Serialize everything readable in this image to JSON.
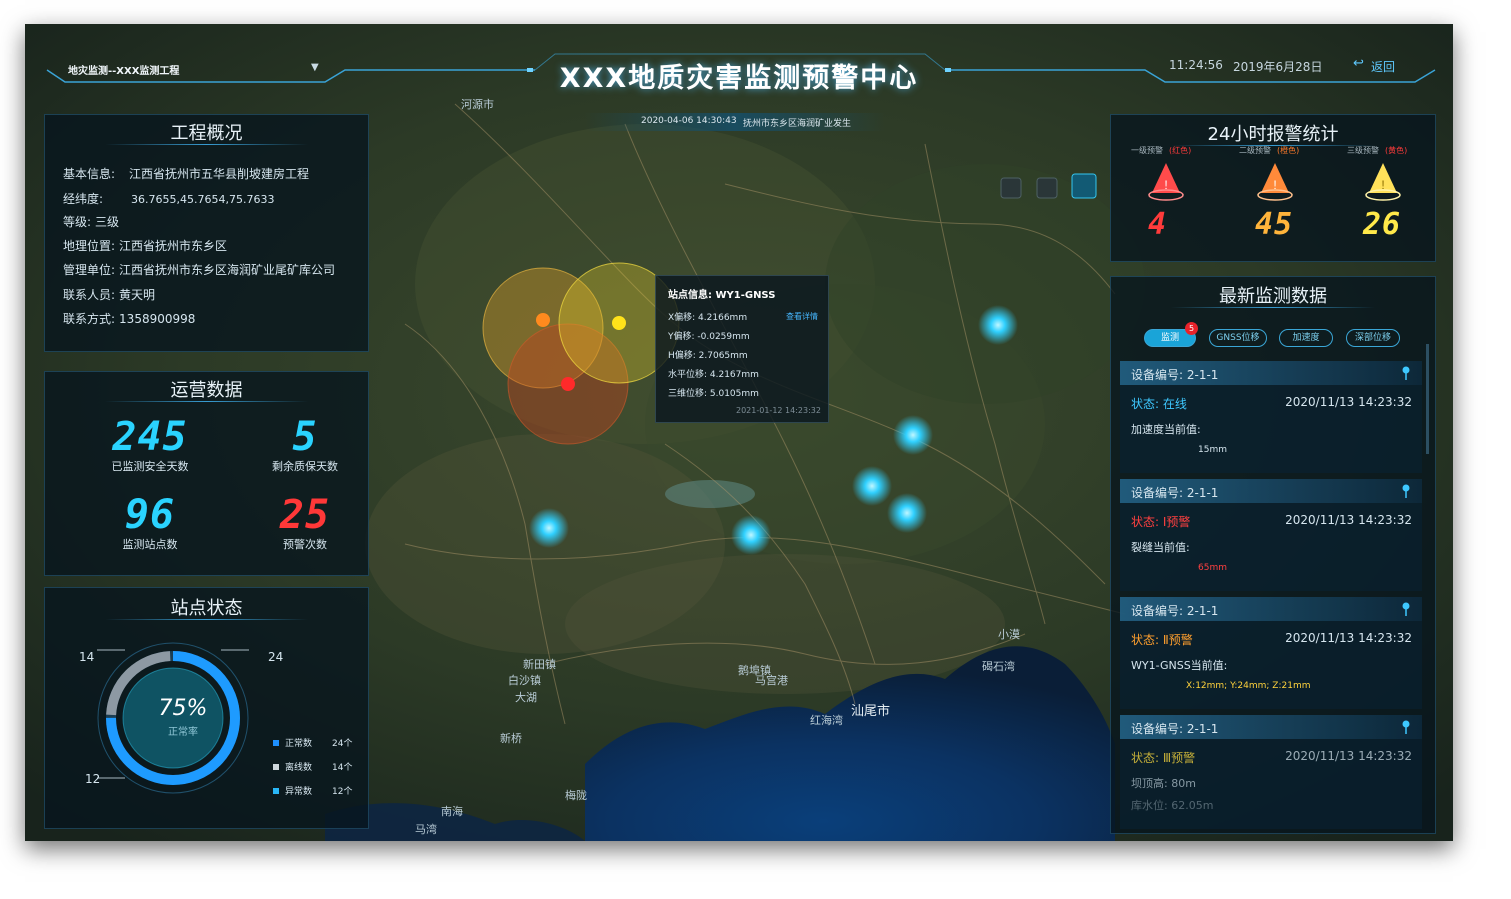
{
  "header": {
    "project_select": "地灾监测--XXX监测工程",
    "title": "XXX地质灾害监测预警中心",
    "time": "11:24:56",
    "date": "2019年6月28日",
    "back_label": "返回"
  },
  "overview": {
    "title": "工程概况",
    "rows": [
      {
        "label": "基本信息:",
        "value": "江西省抚州市五华县削坡建房工程"
      },
      {
        "label": "经纬度:",
        "value": "36.7655,45.7654,75.7633"
      },
      {
        "label": "等级:",
        "value": "三级"
      },
      {
        "label": "地理位置:",
        "value": "江西省抚州市东乡区"
      },
      {
        "label": "管理单位:",
        "value": "江西省抚州市东乡区海润矿业尾矿库公司"
      },
      {
        "label": "联系人员:",
        "value": "黄天明"
      },
      {
        "label": "联系方式:",
        "value": "1358900998"
      }
    ]
  },
  "operation": {
    "title": "运营数据",
    "stats": [
      {
        "value": "245",
        "label": "已监测安全天数",
        "color": "#2ad3ff"
      },
      {
        "value": "5",
        "label": "剩余质保天数",
        "color": "#2ad3ff"
      },
      {
        "value": "96",
        "label": "监测站点数",
        "color": "#2ad3ff"
      },
      {
        "value": "25",
        "label": "预警次数",
        "color": "#ff3838"
      }
    ]
  },
  "station_status": {
    "title": "站点状态",
    "percent_text": "75%",
    "rate_label": "正常率",
    "normal_ratio": 0.75,
    "tick_left_top": "14",
    "tick_right_top": "24",
    "tick_left_bottom": "12",
    "legend": [
      {
        "label": "正常数",
        "value": "24个",
        "color": "#1e90ff"
      },
      {
        "label": "离线数",
        "value": "14个",
        "color": "#cfd8dc"
      },
      {
        "label": "异常数",
        "value": "12个",
        "color": "#29b6f6"
      }
    ]
  },
  "map": {
    "banner_date": "2020-04-06 14:30:43",
    "banner_text": "抚州市东乡区海润矿业发生",
    "popup": {
      "title": "站点信息: WY1-GNSS",
      "detail_link": "查看详情",
      "rows": [
        "X偏移: 4.2166mm",
        "Y偏移: -0.0259mm",
        "H偏移: 2.7065mm",
        "水平位移: 4.2167mm",
        "三维位移: 5.0105mm"
      ],
      "time": "2021-01-12 14:23:32"
    },
    "places": [
      {
        "name": "河源市"
      },
      {
        "name": "汕尾市"
      },
      {
        "name": "新田镇"
      },
      {
        "name": "鹅埠镇"
      },
      {
        "name": "白沙镇"
      },
      {
        "name": "马宫港"
      },
      {
        "name": "红海湾"
      },
      {
        "name": "大湖"
      },
      {
        "name": "碣石湾"
      },
      {
        "name": "小漠"
      },
      {
        "name": "南海"
      },
      {
        "name": "马湾"
      },
      {
        "name": "新桥"
      },
      {
        "name": "梅陇"
      }
    ]
  },
  "alarm_stats": {
    "title": "24小时报警统计",
    "items": [
      {
        "label": "一级预警",
        "tag": "(红色)",
        "value": "4",
        "color": "#ff3b3b"
      },
      {
        "label": "二级预警",
        "tag": "(橙色)",
        "value": "45",
        "color": "#ffb43b"
      },
      {
        "label": "三级预警",
        "tag": "(黄色)",
        "value": "26",
        "color": "#ffe94a"
      }
    ]
  },
  "latest": {
    "title": "最新监测数据",
    "badge": "5",
    "tabs": [
      "监测",
      "GNSS位移",
      "加速度",
      "深部位移"
    ],
    "cards": [
      {
        "device": "设备编号: 2-1-1",
        "status": "状态: 在线",
        "status_color": "#3ec8ff",
        "time": "2020/11/13  14:23:32",
        "metric": "加速度当前值:",
        "value": "15mm",
        "value_color": "#d6e6ef"
      },
      {
        "device": "设备编号: 2-1-1",
        "status": "状态: Ⅰ预警",
        "status_color": "#ff4040",
        "time": "2020/11/13  14:23:32",
        "metric": "裂缝当前值:",
        "value": "65mm",
        "value_color": "#ff4040"
      },
      {
        "device": "设备编号: 2-1-1",
        "status": "状态: Ⅱ预警",
        "status_color": "#ff9f2e",
        "time": "2020/11/13  14:23:32",
        "metric": "WY1-GNSS当前值:",
        "value": "X:12mm; Y:24mm; Z:21mm",
        "value_color": "#ffd23c"
      },
      {
        "device": "设备编号: 2-1-1",
        "status": "状态: Ⅲ预警",
        "status_color": "#e6c93c",
        "time": "2020/11/13  14:23:32",
        "metric": "坝顶高: 80m",
        "value": "库水位: 62.05m",
        "value_color": "#d6e6ef"
      }
    ]
  }
}
